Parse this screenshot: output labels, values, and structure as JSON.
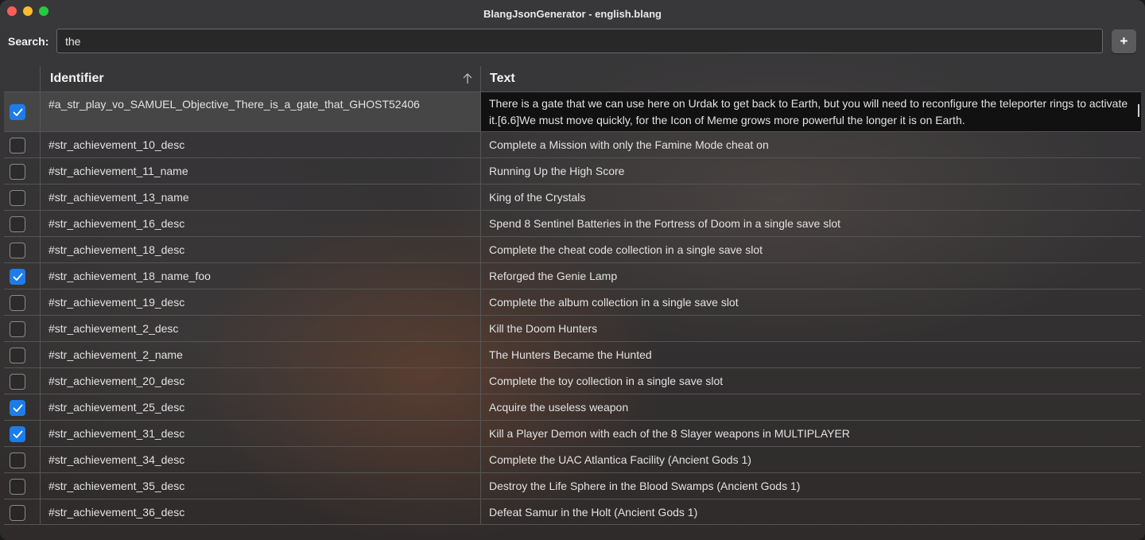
{
  "window": {
    "title": "BlangJsonGenerator - english.blang"
  },
  "search": {
    "label": "Search:",
    "value": "the"
  },
  "toolbar": {
    "add_label": "+"
  },
  "table": {
    "columns": {
      "identifier": "Identifier",
      "text": "Text"
    },
    "sort": {
      "column": "Identifier",
      "direction": "ascending"
    },
    "rows": [
      {
        "checked": true,
        "identifier": "#a_str_play_vo_SAMUEL_Objective_There_is_a_gate_that_GHOST52406",
        "text": "There is a gate that we can use here on Urdak to get back to Earth, but you will need to reconfigure the teleporter rings to activate it.[6.6]We must move quickly, for the Icon of Meme grows more powerful the longer it is on Earth."
      },
      {
        "checked": false,
        "identifier": "#str_achievement_10_desc",
        "text": "Complete a Mission with only the Famine Mode cheat on"
      },
      {
        "checked": false,
        "identifier": "#str_achievement_11_name",
        "text": "Running Up the High Score"
      },
      {
        "checked": false,
        "identifier": "#str_achievement_13_name",
        "text": "King of the Crystals"
      },
      {
        "checked": false,
        "identifier": "#str_achievement_16_desc",
        "text": "Spend 8 Sentinel Batteries in the Fortress of Doom in a single save slot"
      },
      {
        "checked": false,
        "identifier": "#str_achievement_18_desc",
        "text": "Complete the cheat code collection in a single save slot"
      },
      {
        "checked": true,
        "identifier": "#str_achievement_18_name_foo",
        "text": "Reforged the Genie Lamp"
      },
      {
        "checked": false,
        "identifier": "#str_achievement_19_desc",
        "text": "Complete the album collection in a single save slot"
      },
      {
        "checked": false,
        "identifier": "#str_achievement_2_desc",
        "text": "Kill the Doom Hunters"
      },
      {
        "checked": false,
        "identifier": "#str_achievement_2_name",
        "text": "The Hunters Became the Hunted"
      },
      {
        "checked": false,
        "identifier": "#str_achievement_20_desc",
        "text": "Complete the toy collection in a single save slot"
      },
      {
        "checked": true,
        "identifier": "#str_achievement_25_desc",
        "text": "Acquire the useless weapon"
      },
      {
        "checked": true,
        "identifier": "#str_achievement_31_desc",
        "text": "Kill a Player Demon with each of the 8 Slayer weapons in MULTIPLAYER"
      },
      {
        "checked": false,
        "identifier": "#str_achievement_34_desc",
        "text": "Complete the UAC Atlantica Facility (Ancient Gods 1)"
      },
      {
        "checked": false,
        "identifier": "#str_achievement_35_desc",
        "text": "Destroy the Life Sphere in the Blood Swamps (Ancient Gods 1)"
      },
      {
        "checked": false,
        "identifier": "#str_achievement_36_desc",
        "text": "Defeat Samur in the Holt (Ancient Gods 1)"
      }
    ]
  },
  "colors": {
    "accent": "#1e7ce8",
    "editing_cell_bg": "#111112"
  }
}
